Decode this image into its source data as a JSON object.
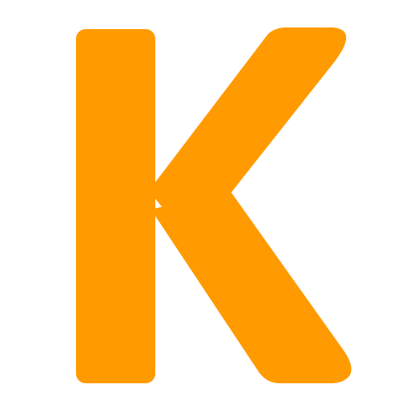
{
  "logo": {
    "letter": "K",
    "color": "#FF9A00",
    "background": "#FFFFFF"
  }
}
